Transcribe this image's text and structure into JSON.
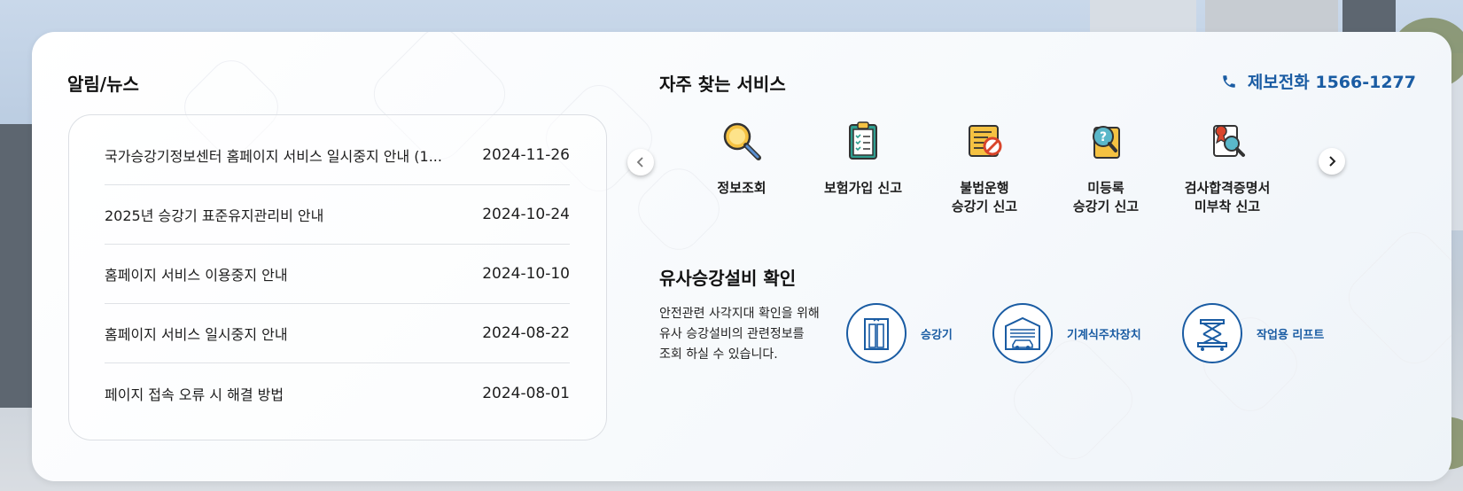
{
  "news": {
    "title": "알림/뉴스",
    "items": [
      {
        "title": "국가승강기정보센터 홈페이지 서비스 일시중지 안내 (1...",
        "date": "2024-11-26"
      },
      {
        "title": "2025년 승강기 표준유지관리비 안내",
        "date": "2024-10-24"
      },
      {
        "title": "홈페이지 서비스 이용중지 안내",
        "date": "2024-10-10"
      },
      {
        "title": "홈페이지 서비스 일시중지 안내",
        "date": "2024-08-22"
      },
      {
        "title": "페이지 접속 오류 시 해결 방법",
        "date": "2024-08-01"
      }
    ]
  },
  "services": {
    "title": "자주 찾는 서비스",
    "hotline": "제보전화 1566-1277",
    "items": [
      {
        "line1": "정보조회",
        "line2": "",
        "icon": "magnifier-icon"
      },
      {
        "line1": "보험가입 신고",
        "line2": "",
        "icon": "clipboard-checklist-icon"
      },
      {
        "line1": "불법운행",
        "line2": "승강기 신고",
        "icon": "prohibited-document-icon"
      },
      {
        "line1": "미등록",
        "line2": "승강기 신고",
        "icon": "question-document-icon"
      },
      {
        "line1": "검사합격증명서",
        "line2": "미부착 신고",
        "icon": "certificate-search-icon"
      }
    ]
  },
  "similar": {
    "title": "유사승강설비 확인",
    "desc": [
      "안전관련 사각지대 확인을 위해",
      "유사 승강설비의 관련정보를",
      "조회 하실 수 있습니다."
    ],
    "items": [
      {
        "label": "승강기",
        "icon": "elevator-icon"
      },
      {
        "label": "기계식주차장치",
        "icon": "parking-garage-icon"
      },
      {
        "label": "작업용 리프트",
        "icon": "scissor-lift-icon"
      }
    ]
  },
  "colors": {
    "accent": "#1a5ca3",
    "text": "#1d1d1d",
    "border": "#dcdfe4"
  }
}
